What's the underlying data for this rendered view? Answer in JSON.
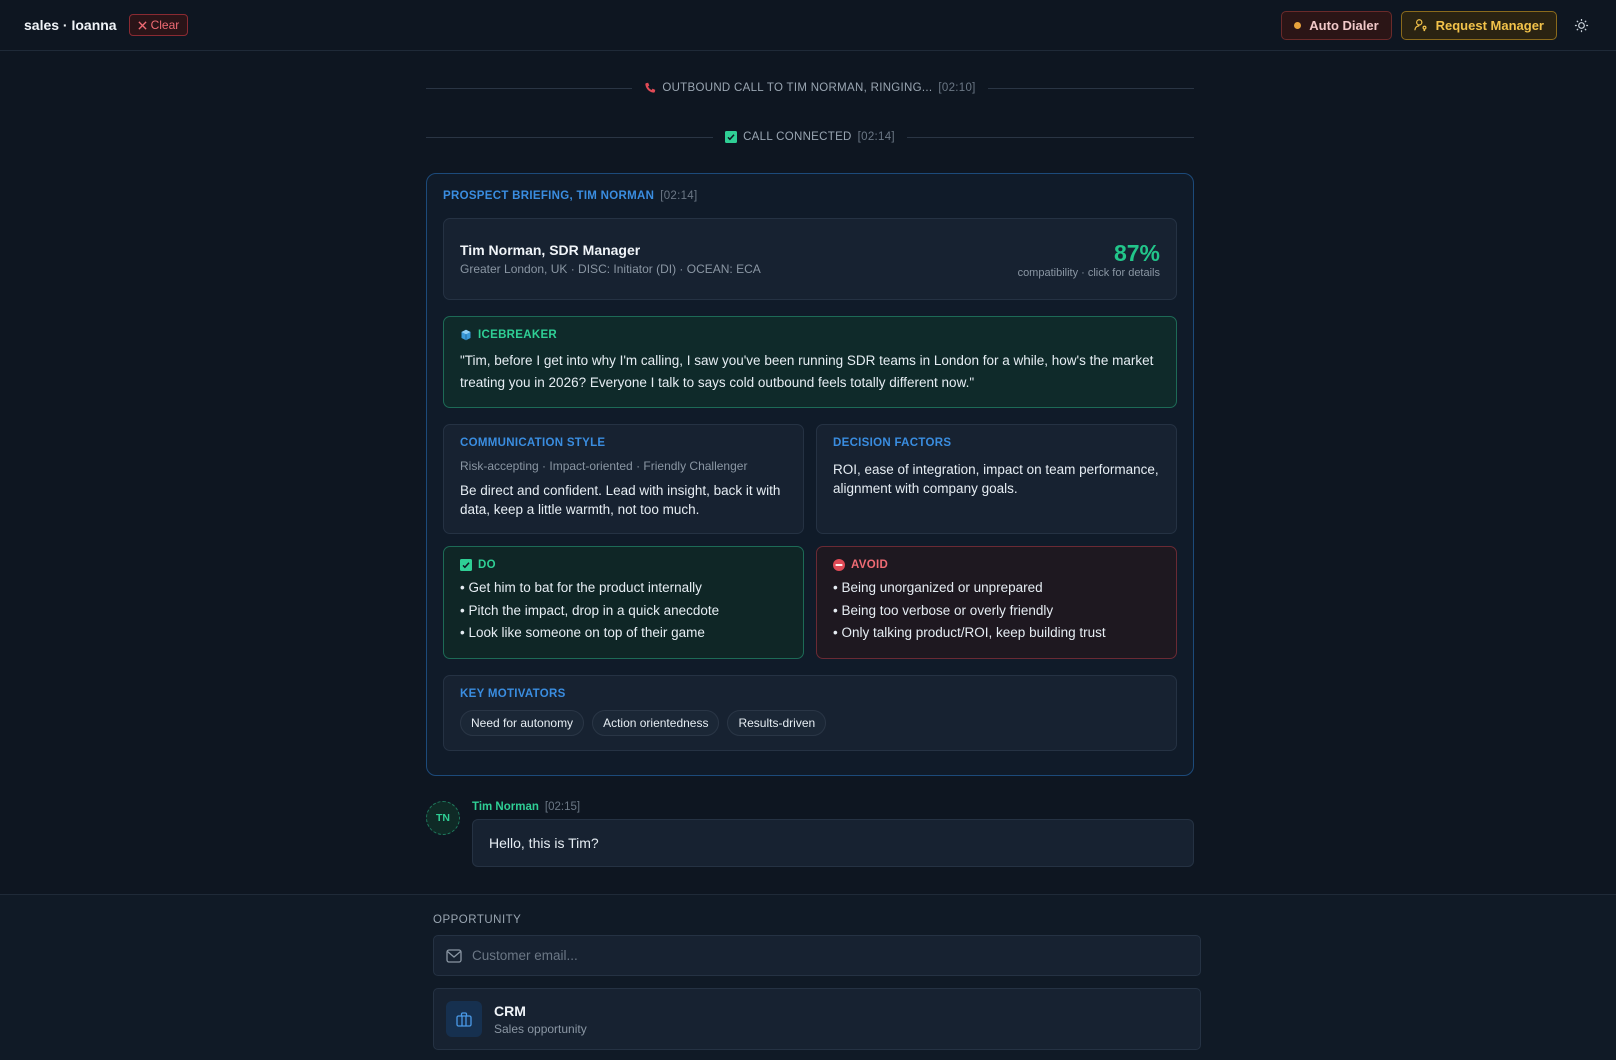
{
  "header": {
    "app_title": "sales · Ioanna",
    "clear_label": "Clear",
    "auto_dialer_label": "Auto Dialer",
    "request_manager_label": "Request Manager"
  },
  "timeline": {
    "outbound": {
      "label": "OUTBOUND CALL TO TIM NORMAN, RINGING...",
      "time": "[02:10]"
    },
    "connected": {
      "label": "CALL CONNECTED",
      "time": "[02:14]"
    }
  },
  "briefing": {
    "title": "PROSPECT BRIEFING, TIM NORMAN",
    "time": "[02:14]",
    "profile": {
      "name": "Tim Norman, SDR Manager",
      "meta": "Greater London, UK · DISC: Initiator (DI) · OCEAN: ECA",
      "compatibility": "87%",
      "compatibility_sub": "compatibility · click for details"
    },
    "icebreaker": {
      "label": "ICEBREAKER",
      "text": "\"Tim, before I get into why I'm calling, I saw you've been running SDR teams in London for a while, how's the market treating you in 2026? Everyone I talk to says cold outbound feels totally different now.\""
    },
    "communication_style": {
      "label": "COMMUNICATION STYLE",
      "tags": "Risk-accepting · Impact-oriented · Friendly Challenger",
      "text": "Be direct and confident. Lead with insight, back it with data, keep a little warmth, not too much."
    },
    "decision_factors": {
      "label": "DECISION FACTORS",
      "text": "ROI, ease of integration, impact on team performance, alignment with company goals."
    },
    "do": {
      "label": "DO",
      "items": [
        "• Get him to bat for the product internally",
        "• Pitch the impact, drop in a quick anecdote",
        "• Look like someone on top of their game"
      ]
    },
    "avoid": {
      "label": "AVOID",
      "items": [
        "• Being unorganized or unprepared",
        "• Being too verbose or overly friendly",
        "• Only talking product/ROI, keep building trust"
      ]
    },
    "motivators": {
      "label": "KEY MOTIVATORS",
      "chips": [
        "Need for autonomy",
        "Action orientedness",
        "Results-driven"
      ]
    }
  },
  "message": {
    "avatar_initials": "TN",
    "author": "Tim Norman",
    "time": "[02:15]",
    "text": "Hello, this is Tim?"
  },
  "opportunity": {
    "label": "OPPORTUNITY",
    "email_placeholder": "Customer email...",
    "crm_title": "CRM",
    "crm_subtitle": "Sales opportunity"
  },
  "colors": {
    "accent_blue": "#3a8de0",
    "success_green": "#22c58a",
    "danger_red": "#ef6b74",
    "warning_gold": "#f2c24a"
  }
}
